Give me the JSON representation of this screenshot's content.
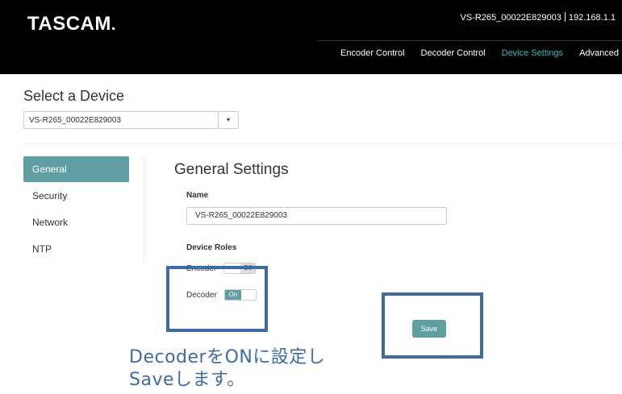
{
  "header": {
    "logo": "TASCAM",
    "logo_dot": ".",
    "device_name": "VS-R265_00022E829003",
    "ip": "192.168.1.1",
    "nav": [
      "Encoder Control",
      "Decoder Control",
      "Device Settings",
      "Advanced"
    ],
    "active_nav": "Device Settings",
    "accent_color": "#3fb6c4"
  },
  "device_select": {
    "title": "Select a Device",
    "selected": "VS-R265_00022E829003",
    "caret": "▾"
  },
  "sidebar": {
    "items": [
      {
        "label": "General",
        "active": true
      },
      {
        "label": "Security"
      },
      {
        "label": "Network"
      },
      {
        "label": "NTP"
      }
    ]
  },
  "general": {
    "title": "General Settings",
    "name_label": "Name",
    "name_value": "VS-R265_00022E829003",
    "roles_label": "Device Roles",
    "encoder_label": "Encoder",
    "encoder_state": "Off",
    "decoder_label": "Decoder",
    "decoder_state": "On",
    "save_label": "Save"
  },
  "annotation": {
    "line1": "DecoderをONに設定し",
    "line2": "Saveします。",
    "color": "#3f6aa3"
  }
}
